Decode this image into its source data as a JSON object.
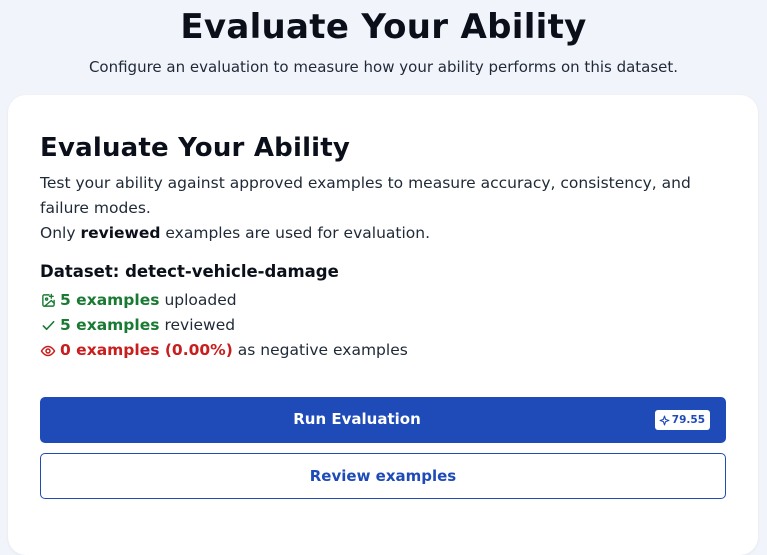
{
  "header": {
    "title": "Evaluate Your Ability",
    "subtitle": "Configure an evaluation to measure how your ability performs on this dataset."
  },
  "card": {
    "title": "Evaluate Your Ability",
    "description": "Test your ability against approved examples to measure accuracy, consistency, and failure modes.",
    "note_prefix": "Only",
    "note_bold": "reviewed",
    "note_suffix": "examples are used for evaluation.",
    "dataset_title": "Dataset: detect-vehicle-damage",
    "stats": [
      {
        "icon": "image-upload-icon",
        "value": "5 examples",
        "label": "uploaded",
        "color": "#1a7a33"
      },
      {
        "icon": "check-icon",
        "value": "5 examples",
        "label": "reviewed",
        "color": "#1a7a33"
      },
      {
        "icon": "eye-icon",
        "value": "0 examples (0.00%)",
        "label": "as negative examples",
        "color": "#c81e1e"
      }
    ]
  },
  "actions": {
    "run_label": "Run Evaluation",
    "run_credits": "79.55",
    "credits_icon": "sparkle-icon",
    "review_label": "Review examples"
  },
  "colors": {
    "primary": "#1e4bb8",
    "success": "#1a7a33",
    "danger": "#c81e1e",
    "background": "#f2f4fb"
  }
}
